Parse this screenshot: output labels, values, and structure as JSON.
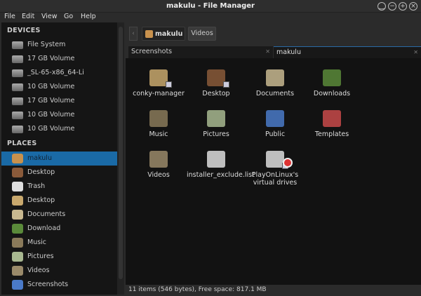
{
  "window": {
    "title": "makulu - File Manager"
  },
  "menu": [
    "File",
    "Edit",
    "View",
    "Go",
    "Help"
  ],
  "sidebar": {
    "devices_title": "DEVICES",
    "devices": [
      "File System",
      "17 GB Volume",
      "_SL-65-x86_64-Li",
      "10 GB Volume",
      "17 GB Volume",
      "10 GB Volume",
      "10 GB Volume"
    ],
    "places_title": "PLACES",
    "places": [
      {
        "label": "makulu",
        "icon": "home-folder-icon",
        "color": "#c8914d",
        "selected": true
      },
      {
        "label": "Desktop",
        "icon": "desktop-icon",
        "color": "#8a5a3a"
      },
      {
        "label": "Trash",
        "icon": "trash-icon",
        "color": "#ddd"
      },
      {
        "label": "Desktop",
        "icon": "folder-icon",
        "color": "#c8a86d"
      },
      {
        "label": "Documents",
        "icon": "documents-folder-icon",
        "color": "#c8b890"
      },
      {
        "label": "Download",
        "icon": "downloads-folder-icon",
        "color": "#5a8a3a"
      },
      {
        "label": "Music",
        "icon": "music-folder-icon",
        "color": "#8a7a5a"
      },
      {
        "label": "Pictures",
        "icon": "pictures-folder-icon",
        "color": "#a8b890"
      },
      {
        "label": "Videos",
        "icon": "videos-folder-icon",
        "color": "#9a8a6a"
      },
      {
        "label": "Screenshots",
        "icon": "public-folder-icon",
        "color": "#4a7ac8"
      }
    ]
  },
  "pathbar": {
    "crumbs": [
      "makulu",
      "Videos"
    ]
  },
  "tabs": [
    {
      "label": "Screenshots",
      "active": false
    },
    {
      "label": "makulu",
      "active": true
    }
  ],
  "files": [
    {
      "label": "conky-manager",
      "icon": "folder-link-icon",
      "color": "#c8a86d"
    },
    {
      "label": "Desktop",
      "icon": "desktop-link-icon",
      "color": "#8a5a3a"
    },
    {
      "label": "Documents",
      "icon": "documents-folder-icon",
      "color": "#c8b890"
    },
    {
      "label": "Downloads",
      "icon": "downloads-folder-icon",
      "color": "#5a8a3a"
    },
    {
      "label": "Music",
      "icon": "music-folder-icon",
      "color": "#8a7a5a"
    },
    {
      "label": "Pictures",
      "icon": "pictures-folder-icon",
      "color": "#a8b890"
    },
    {
      "label": "Public",
      "icon": "public-folder-icon",
      "color": "#4a7ac8"
    },
    {
      "label": "Templates",
      "icon": "templates-folder-icon",
      "color": "#c84a4a"
    },
    {
      "label": "Videos",
      "icon": "videos-folder-icon",
      "color": "#9a8a6a"
    },
    {
      "label": "installer_exclude.list",
      "icon": "text-file-icon",
      "color": "#ddd"
    },
    {
      "label": "PlayOnLinux's virtual drives",
      "icon": "broken-link-icon",
      "color": "#ddd"
    }
  ],
  "status": "11 items (546 bytes), Free space: 817.1 MB",
  "colors": {
    "selection": "#1a6aa6",
    "sidebar_bg": "#151515",
    "view_bg": "#121212"
  }
}
